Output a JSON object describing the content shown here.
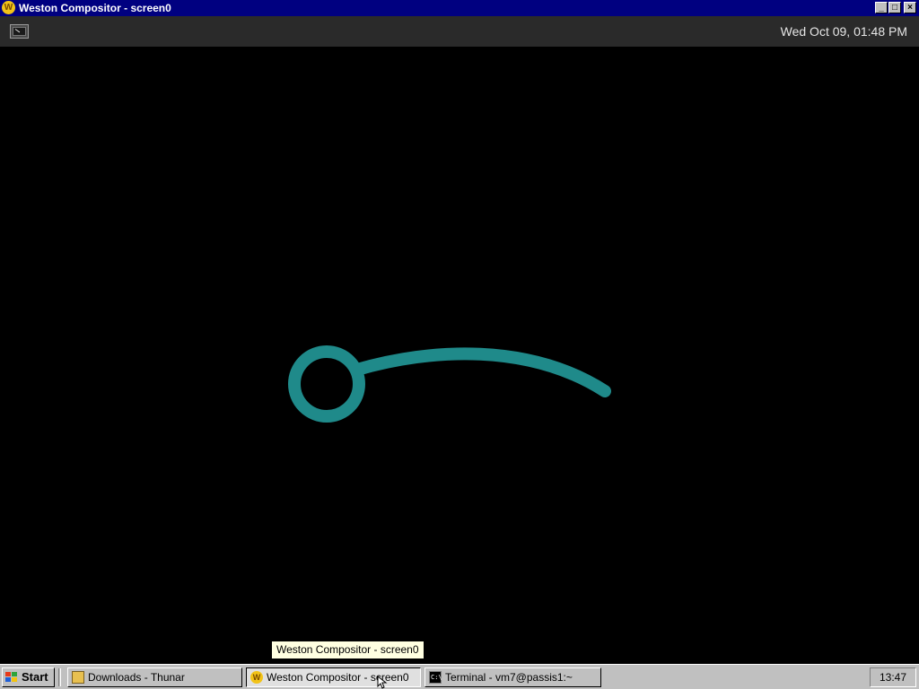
{
  "window": {
    "title": "Weston Compositor - screen0",
    "icon": "weston-icon",
    "buttons": {
      "minimize": "_",
      "maximize": "□",
      "close": "×"
    }
  },
  "panel": {
    "launcher_icon": "terminal-launcher-icon",
    "clock": "Wed Oct 09, 01:48 PM"
  },
  "canvas": {
    "background": "#000000",
    "stroke_color": "#1f8a8a",
    "drawing": "teal-curve-with-circle"
  },
  "tooltip": {
    "text": "Weston Compositor - screen0"
  },
  "taskbar": {
    "start_label": "Start",
    "tasks": [
      {
        "label": "Downloads - Thunar",
        "icon": "folder-icon",
        "active": false
      },
      {
        "label": "Weston Compositor - screen0",
        "icon": "weston-icon",
        "active": true
      },
      {
        "label": "Terminal - vm7@passis1:~",
        "icon": "terminal-icon",
        "active": false
      }
    ],
    "clock": "13:47"
  }
}
